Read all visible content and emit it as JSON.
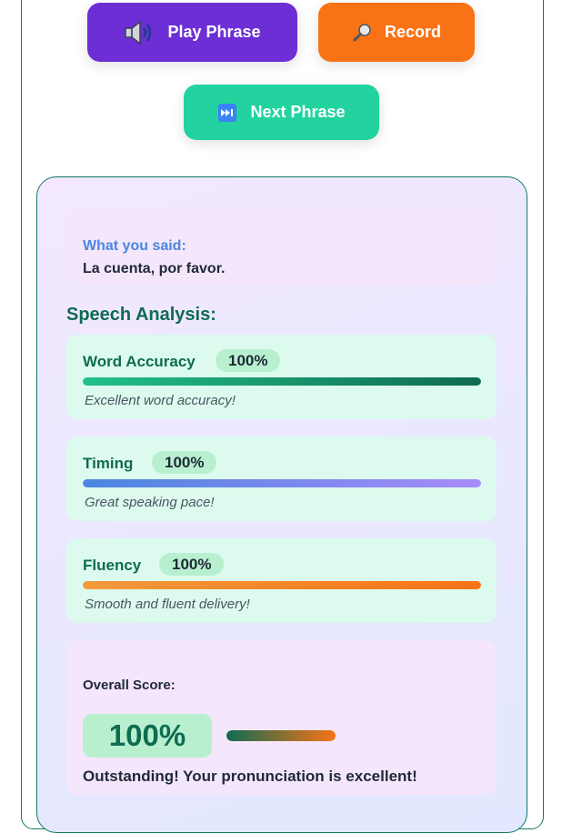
{
  "buttons": {
    "play": {
      "label": "Play Phrase",
      "icon": "speaker-icon"
    },
    "record": {
      "label": "Record",
      "icon": "microphone-icon"
    },
    "next": {
      "label": "Next Phrase",
      "icon": "next-track-icon"
    }
  },
  "transcript": {
    "label": "What you said:",
    "text": "La cuenta, por favor."
  },
  "analysis": {
    "title": "Speech Analysis:",
    "metrics": [
      {
        "name": "Word Accuracy",
        "score": "100%",
        "value": 100,
        "message": "Excellent word accuracy!",
        "color_start": "#22c08a",
        "color_end": "#0f6b52"
      },
      {
        "name": "Timing",
        "score": "100%",
        "value": 100,
        "message": "Great speaking pace!",
        "color_start": "#4a86e0",
        "color_end": "#a78bfa"
      },
      {
        "name": "Fluency",
        "score": "100%",
        "value": 100,
        "message": "Smooth and fluent delivery!",
        "color_start": "#f39a3d",
        "color_end": "#f97316"
      }
    ]
  },
  "overall": {
    "label": "Overall Score:",
    "score": "100%",
    "value": 100,
    "message": "Outstanding! Your pronunciation is excellent!"
  },
  "colors": {
    "accent_green": "#0f6b52",
    "play_button": "#6d2ed6",
    "record_button": "#f97316",
    "next_button": "#22d3a0"
  }
}
